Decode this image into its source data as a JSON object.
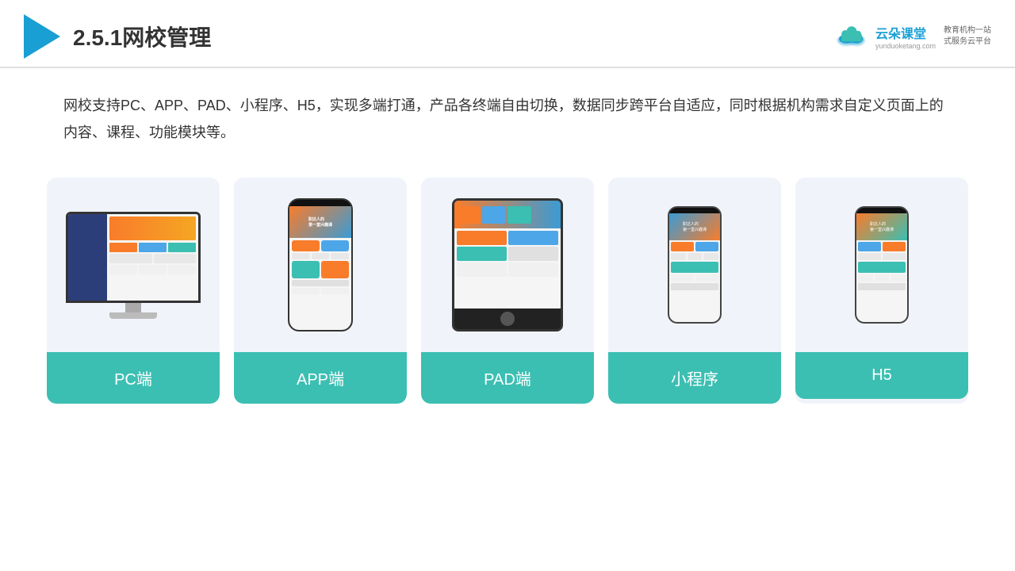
{
  "header": {
    "title": "2.5.1网校管理",
    "brand": {
      "name": "云朵课堂",
      "url": "yunduoketang.com",
      "slogan": "教育机构一站\n式服务云平台"
    }
  },
  "description": "网校支持PC、APP、PAD、小程序、H5，实现多端打通，产品各终端自由切换，数据同步跨平台自适应，同时根据机构需求自定义页面上的内容、课程、功能模块等。",
  "cards": [
    {
      "id": "pc",
      "label": "PC端"
    },
    {
      "id": "app",
      "label": "APP端"
    },
    {
      "id": "pad",
      "label": "PAD端"
    },
    {
      "id": "miniapp",
      "label": "小程序"
    },
    {
      "id": "h5",
      "label": "H5"
    }
  ],
  "colors": {
    "accent": "#3bbfb2",
    "blue": "#1a9fd4",
    "orange": "#f97c2b"
  }
}
